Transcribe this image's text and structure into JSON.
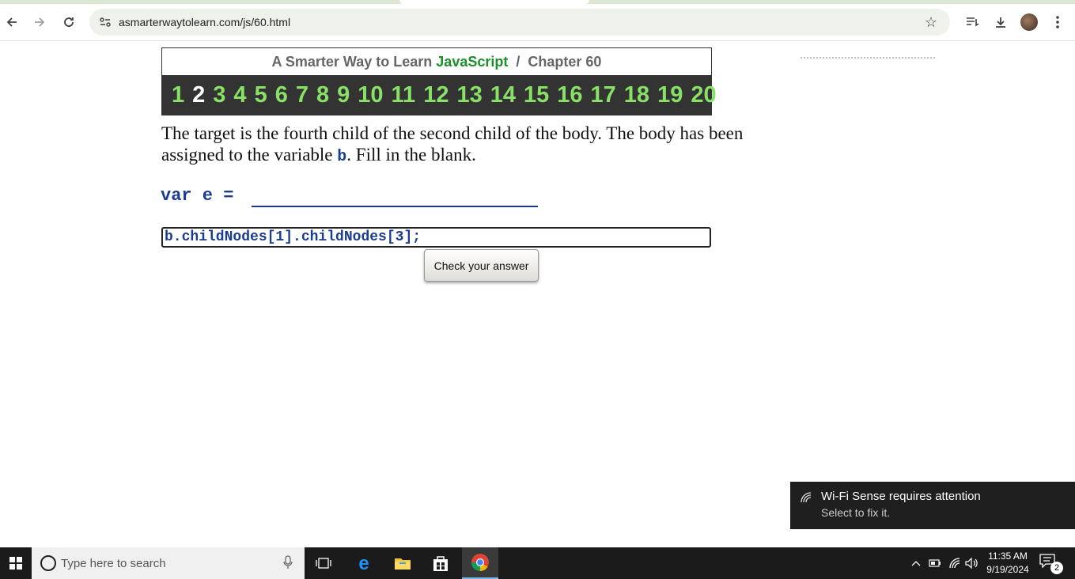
{
  "browser": {
    "url": "asmarterwaytolearn.com/js/60.html"
  },
  "page": {
    "header_prefix": "A Smarter Way to Learn",
    "header_brand": "JavaScript",
    "header_sep": "/",
    "header_chapter": "Chapter 60",
    "chapters": [
      "1",
      "2",
      "3",
      "4",
      "5",
      "6",
      "7",
      "8",
      "9",
      "10",
      "11",
      "12",
      "13",
      "14",
      "15",
      "16",
      "17",
      "18",
      "19",
      "20"
    ],
    "current_chapter": "2",
    "instruction_part1": "The target is the fourth child of the second child of the body. The body has been assigned to the variable",
    "instruction_code": "b",
    "instruction_part2": ". Fill in the blank.",
    "code_prefix": "var e =",
    "answer_value": "b.childNodes[1].childNodes[3];",
    "check_button": "Check your answer",
    "colors": {
      "brand": "#1a8f2a",
      "chapter": "#88e066",
      "code": "#1a3c8f"
    }
  },
  "toast": {
    "title": "Wi-Fi Sense requires attention",
    "subtitle": "Select to fix it."
  },
  "taskbar": {
    "search_placeholder": "Type here to search",
    "time": "11:35 AM",
    "date": "9/19/2024",
    "notification_count": "2"
  }
}
